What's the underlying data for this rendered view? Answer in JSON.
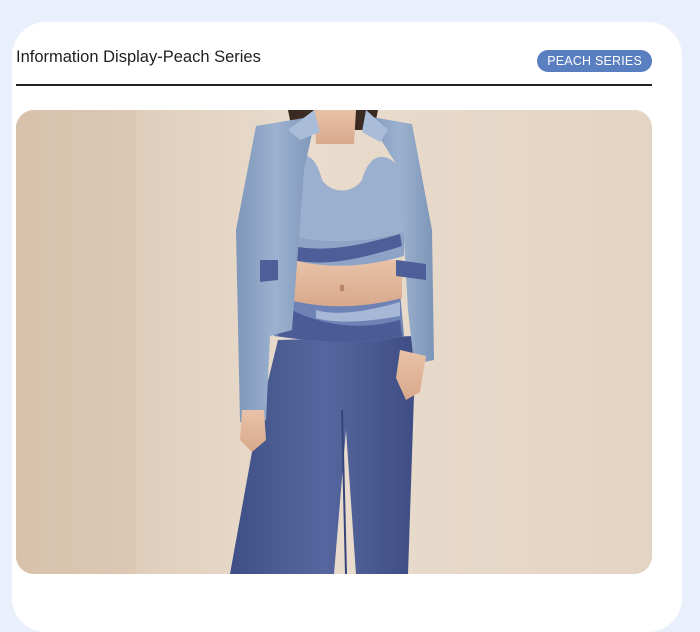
{
  "header": {
    "title": "Information Display-Peach Series",
    "badge": "PEACH SERIES"
  },
  "photo": {
    "subject": "model-in-blue-activewear"
  },
  "colors": {
    "page_background": "#e9effb",
    "card_background": "#ffffff",
    "badge_background": "#5a7fc0",
    "divider": "#222222",
    "jacket_blue": "#8fa6c6",
    "legging_navy": "#4b5c96",
    "backdrop_beige": "#e6d8c8"
  }
}
